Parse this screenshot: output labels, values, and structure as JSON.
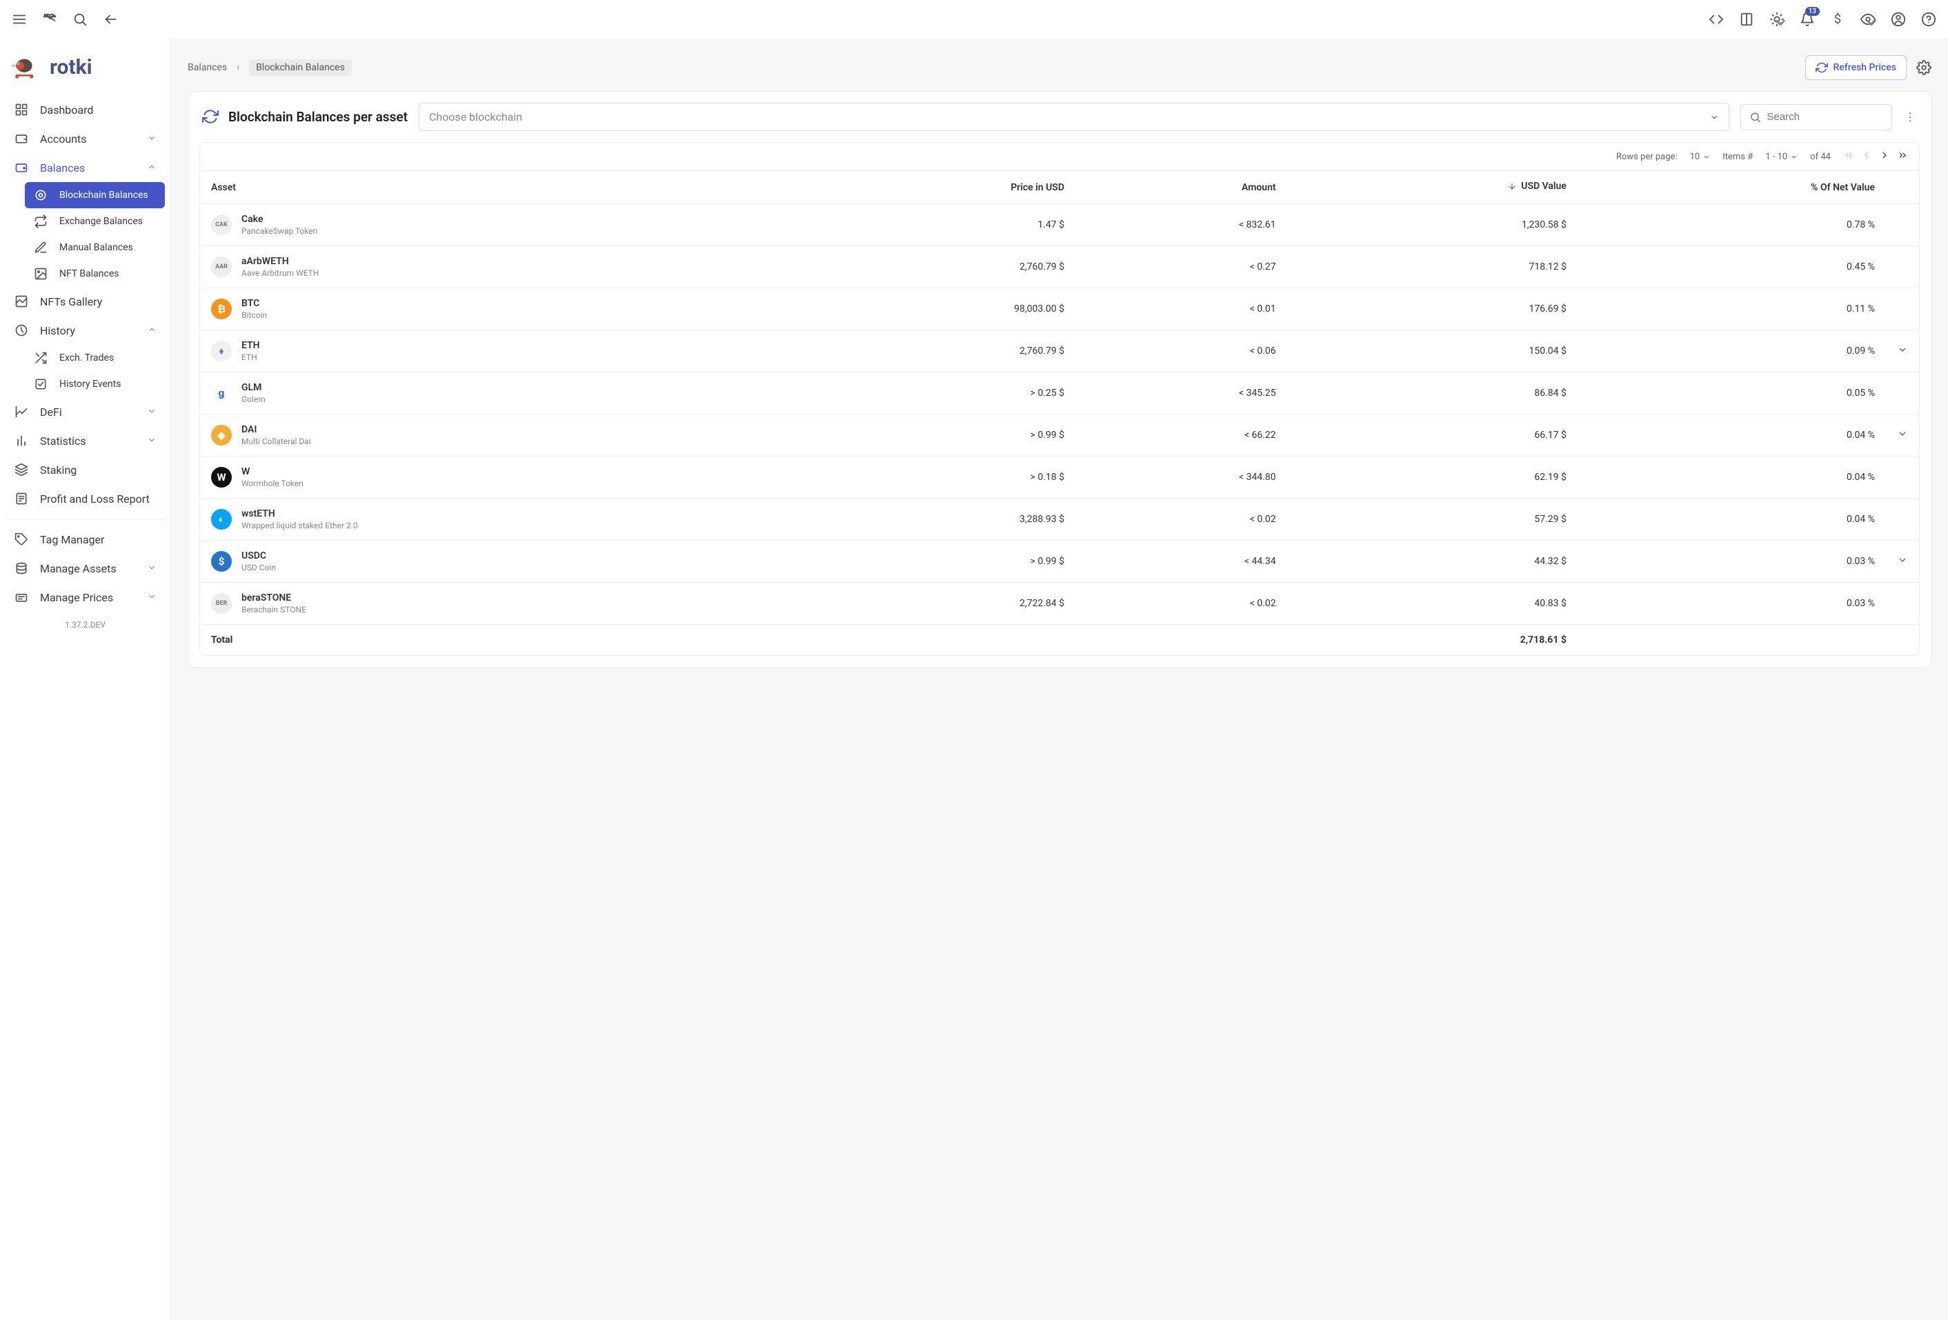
{
  "header": {
    "notification_count": "13"
  },
  "sidebar": {
    "logo_text": "rotki",
    "version": "1.37.2.DEV",
    "items": {
      "dashboard": "Dashboard",
      "accounts": "Accounts",
      "balances": "Balances",
      "blockchain_balances": "Blockchain Balances",
      "exchange_balances": "Exchange Balances",
      "manual_balances": "Manual Balances",
      "nft_balances": "NFT Balances",
      "nfts_gallery": "NFTs Gallery",
      "history": "History",
      "exch_trades": "Exch. Trades",
      "history_events": "History Events",
      "defi": "DeFi",
      "statistics": "Statistics",
      "staking": "Staking",
      "pnl": "Profit and Loss Report",
      "tag_manager": "Tag Manager",
      "manage_assets": "Manage Assets",
      "manage_prices": "Manage Prices"
    }
  },
  "breadcrumb": {
    "root": "Balances",
    "current": "Blockchain Balances",
    "refresh_btn": "Refresh Prices"
  },
  "panel": {
    "title": "Blockchain Balances per asset",
    "blockchain_placeholder": "Choose blockchain",
    "search_placeholder": "Search"
  },
  "pager": {
    "rows_label": "Rows per page:",
    "rows_value": "10",
    "items_label": "Items #",
    "range": "1 - 10",
    "of": "of 44"
  },
  "table": {
    "headers": {
      "asset": "Asset",
      "price": "Price in USD",
      "amount": "Amount",
      "usd": "USD Value",
      "pct": "% Of Net Value"
    },
    "rows": [
      {
        "sym": "Cake",
        "name": "PancakeSwap Token",
        "price": "1.47 $",
        "amount": "< 832.61",
        "usd": "1,230.58 $",
        "pct": "0.78 %",
        "icon": "CAK",
        "bg": "#eee",
        "fg": "#777",
        "exp": ""
      },
      {
        "sym": "aArbWETH",
        "name": "Aave Arbitrum WETH",
        "price": "2,760.79 $",
        "amount": "< 0.27",
        "usd": "718.12 $",
        "pct": "0.45 %",
        "icon": "AAR",
        "bg": "#eee",
        "fg": "#777",
        "exp": ""
      },
      {
        "sym": "BTC",
        "name": "Bitcoin",
        "price": "98,003.00 $",
        "amount": "< 0.01",
        "usd": "176.69 $",
        "pct": "0.11 %",
        "icon": "₿",
        "bg": "#f7931a",
        "fg": "#fff",
        "exp": ""
      },
      {
        "sym": "ETH",
        "name": "ETH",
        "price": "2,760.79 $",
        "amount": "< 0.06",
        "usd": "150.04 $",
        "pct": "0.09 %",
        "icon": "♦",
        "bg": "#f0f0f0",
        "fg": "#627eea",
        "exp": "⌄"
      },
      {
        "sym": "GLM",
        "name": "Golem",
        "price": "> 0.25 $",
        "amount": "< 345.25",
        "usd": "86.84 $",
        "pct": "0.05 %",
        "icon": "ǥ",
        "bg": "#fff",
        "fg": "#3b5bdb",
        "exp": ""
      },
      {
        "sym": "DAI",
        "name": "Multi Collateral Dai",
        "price": "> 0.99 $",
        "amount": "< 66.22",
        "usd": "66.17 $",
        "pct": "0.04 %",
        "icon": "◈",
        "bg": "#f5ac37",
        "fg": "#fff",
        "exp": "⌄"
      },
      {
        "sym": "W",
        "name": "Wormhole Token",
        "price": "> 0.18 $",
        "amount": "< 344.80",
        "usd": "62.19 $",
        "pct": "0.04 %",
        "icon": "W",
        "bg": "#111",
        "fg": "#fff",
        "exp": ""
      },
      {
        "sym": "wstETH",
        "name": "Wrapped liquid staked Ether 2.0",
        "price": "3,288.93 $",
        "amount": "< 0.02",
        "usd": "57.29 $",
        "pct": "0.04 %",
        "icon": "◐",
        "bg": "#00a3ff",
        "fg": "#fff",
        "exp": ""
      },
      {
        "sym": "USDC",
        "name": "USD Coin",
        "price": "> 0.99 $",
        "amount": "< 44.34",
        "usd": "44.32 $",
        "pct": "0.03 %",
        "icon": "$",
        "bg": "#2775ca",
        "fg": "#fff",
        "exp": "⌄"
      },
      {
        "sym": "beraSTONE",
        "name": "Berachain STONE",
        "price": "2,722.84 $",
        "amount": "< 0.02",
        "usd": "40.83 $",
        "pct": "0.03 %",
        "icon": "BER",
        "bg": "#eee",
        "fg": "#777",
        "exp": ""
      }
    ],
    "total_label": "Total",
    "total_usd": "2,718.61 $"
  }
}
